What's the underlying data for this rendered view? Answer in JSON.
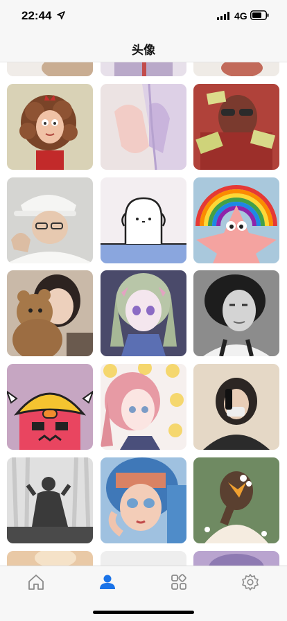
{
  "status_bar": {
    "time": "22:44",
    "network": "4G"
  },
  "nav": {
    "title": "头像"
  },
  "avatars": [
    "curly-hair-girl",
    "hands-anime-illustration",
    "sunglasses-money-character",
    "white-cap-boy",
    "white-blob-cartoon",
    "patrick-star-rainbow",
    "girl-with-teddy-bear",
    "anime-girl-purple-eyes",
    "black-white-woman-portrait",
    "cartoon-chick-hat",
    "pink-hair-anime-girl",
    "mirror-selfie-girl",
    "silhouette-by-window",
    "blue-hair-anime-girl",
    "girl-with-flower-hair"
  ],
  "tabs": [
    {
      "name": "home",
      "icon": "home-icon",
      "active": false
    },
    {
      "name": "avatar",
      "icon": "person-icon",
      "active": true
    },
    {
      "name": "categories",
      "icon": "grid-icon",
      "active": false
    },
    {
      "name": "settings",
      "icon": "gear-icon",
      "active": false
    }
  ],
  "colors": {
    "active_tab": "#1a73e8",
    "inactive_tab": "#8a8a8a"
  }
}
